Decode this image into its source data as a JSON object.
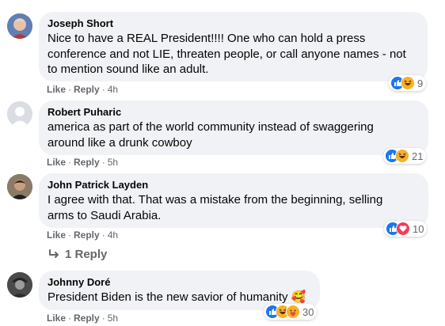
{
  "comments": [
    {
      "author": "Joseph Short",
      "lines": [
        "Nice to have a REAL President!!!! One who can hold a press",
        "conference and not LIE, threaten people, or call anyone names - not",
        "to mention sound like an adult."
      ],
      "like": "Like",
      "reply": "Reply",
      "time": "4h",
      "reactions": [
        "like",
        "haha"
      ],
      "reaction_count": "9"
    },
    {
      "author": "Robert Puharic",
      "lines": [
        "america as part of the world community instead of swaggering",
        "around like a drunk cowboy"
      ],
      "like": "Like",
      "reply": "Reply",
      "time": "5h",
      "reactions": [
        "like",
        "haha"
      ],
      "reaction_count": "21"
    },
    {
      "author": "John Patrick Layden",
      "lines": [
        "I agree with that. That was a mistake from the beginning, selling",
        "arms to Saudi Arabia."
      ],
      "like": "Like",
      "reply": "Reply",
      "time": "4h",
      "reactions": [
        "like",
        "love"
      ],
      "reaction_count": "10"
    },
    {
      "author": "Johnny Doré",
      "lines": [
        "President Biden is the new savior of humanity 🥰"
      ],
      "like": "Like",
      "reply": "Reply",
      "time": "5h",
      "reactions": [
        "like",
        "haha",
        "care"
      ],
      "reaction_count": "30"
    }
  ],
  "replies_link": "1 Reply",
  "colors": {
    "like": "#1877f2",
    "love": "#f33e58",
    "haha": "#f7b125",
    "bubble": "#f0f2f5",
    "meta": "#65676b"
  }
}
